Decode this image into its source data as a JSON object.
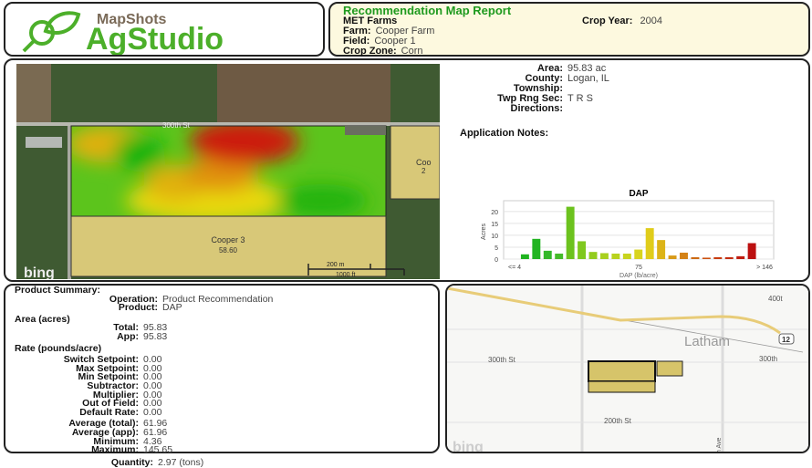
{
  "logo": {
    "brand": "MapShots",
    "product": "AgStudio"
  },
  "header": {
    "title": "Recommendation Map Report",
    "company": "MET Farms",
    "crop_year_label": "Crop Year:",
    "crop_year": "2004",
    "farm_label": "Farm:",
    "farm": "Cooper Farm",
    "field_label": "Field:",
    "field": "Cooper 1",
    "crop_zone_label": "Crop Zone:",
    "crop_zone": "Corn"
  },
  "field_map": {
    "neighbor_field": "Cooper 3",
    "neighbor_area": "58.60",
    "neighbor_right": "Coo",
    "neighbor_right_area": "2",
    "road": "300th St",
    "scale_m": "200 m",
    "scale_ft": "1000 ft",
    "attribution": "bing"
  },
  "field_info": [
    {
      "label": "Area:",
      "value": "95.83 ac"
    },
    {
      "label": "County:",
      "value": "Logan, IL"
    },
    {
      "label": "Township:",
      "value": ""
    },
    {
      "label": "Twp Rng Sec:",
      "value": "T  R  S"
    },
    {
      "label": "Directions:",
      "value": ""
    }
  ],
  "notes_label": "Application Notes:",
  "chart_data": {
    "type": "bar",
    "title": "DAP",
    "xlabel": "DAP (lb/acre)",
    "ylabel": "Acres",
    "ylim": [
      0,
      23
    ],
    "yticks": [
      0,
      5,
      10,
      15,
      20
    ],
    "xtick_labels": [
      "<= 4",
      "75",
      "> 146"
    ],
    "values": [
      0,
      2,
      8.5,
      3.5,
      2.3,
      22,
      7.5,
      3,
      2.5,
      2.3,
      2.3,
      4,
      13,
      8,
      1.5,
      2.7,
      0.8,
      0.6,
      0.8,
      0.8,
      1.2,
      6.7,
      0
    ],
    "colors": [
      "#1fb41f",
      "#1fb41f",
      "#22b422",
      "#33b82a",
      "#44bb2a",
      "#6cc21e",
      "#7fc81e",
      "#93cc1e",
      "#a8d01e",
      "#b8d21e",
      "#c8d41e",
      "#d8d41e",
      "#e0cc1a",
      "#dcb418",
      "#d89a18",
      "#d48216",
      "#cc6a14",
      "#cc5212",
      "#c83c10",
      "#c42c10",
      "#c01c10",
      "#bc1010",
      "#bc1010"
    ]
  },
  "summary": {
    "title": "Product Summary:",
    "operation_label": "Operation:",
    "operation": "Product Recommendation",
    "product_label": "Product:",
    "product": "DAP",
    "area_title": "Area (acres)",
    "total_label": "Total:",
    "total": "95.83",
    "app_label": "App:",
    "app": "95.83",
    "rate_title": "Rate (pounds/acre)",
    "rates": [
      {
        "label": "Switch Setpoint:",
        "value": "0.00"
      },
      {
        "label": "Max Setpoint:",
        "value": "0.00"
      },
      {
        "label": "Min Setpoint:",
        "value": "0.00"
      },
      {
        "label": "Subtractor:",
        "value": "0.00"
      },
      {
        "label": "Multiplier:",
        "value": "0.00"
      },
      {
        "label": "Out of Field:",
        "value": "0.00"
      },
      {
        "label": "Default Rate:",
        "value": "0.00"
      }
    ],
    "stats": [
      {
        "label": "Average (total):",
        "value": "61.96"
      },
      {
        "label": "Average (app):",
        "value": "61.96"
      },
      {
        "label": "Minimum:",
        "value": "4.36"
      },
      {
        "label": "Maximum:",
        "value": "145.65"
      }
    ],
    "quantity_label": "Quantity:",
    "quantity": "2.97 (tons)"
  },
  "locator_map": {
    "town": "Latham",
    "road1": "300th St",
    "road2": "300th",
    "road3": "200th St",
    "road4": "400t",
    "road5": "h Ave",
    "highway": "12",
    "attribution": "bing"
  }
}
